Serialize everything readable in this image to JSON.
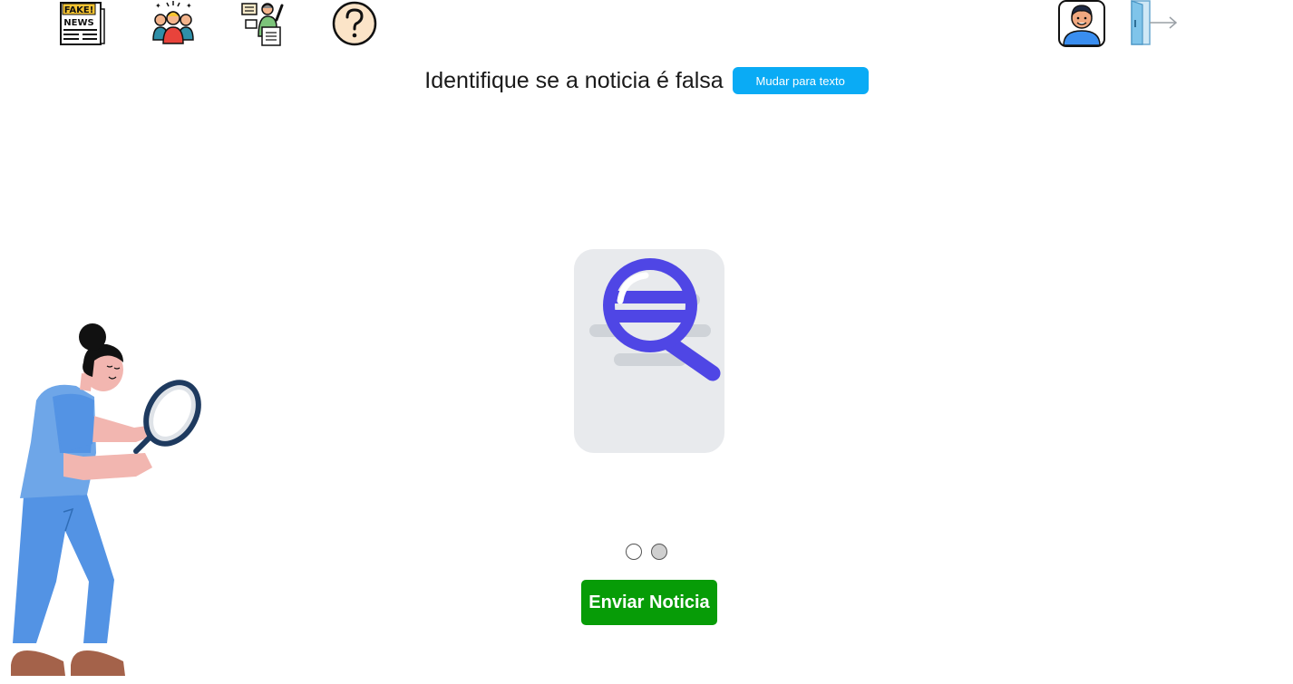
{
  "nav": {
    "items": [
      {
        "icon": "fake-news-icon",
        "sign_top": "FAKE!",
        "sign_bottom": "NEWS"
      },
      {
        "icon": "community-icon"
      },
      {
        "icon": "presenter-icon"
      },
      {
        "icon": "help-question-icon"
      }
    ],
    "profile_icon": "user-avatar-icon",
    "logout_icon": "logout-door-icon"
  },
  "header": {
    "title": "Identifique se a noticia é falsa",
    "mode_button": "Mudar para texto"
  },
  "carousel": {
    "slides": 2,
    "active_index": 0
  },
  "actions": {
    "send_button": "Enviar Noticia"
  },
  "colors": {
    "mode_button": "#0aabf5",
    "send_button": "#079c07",
    "magnifier": "#4f46e5",
    "document": "#e8eaed"
  }
}
